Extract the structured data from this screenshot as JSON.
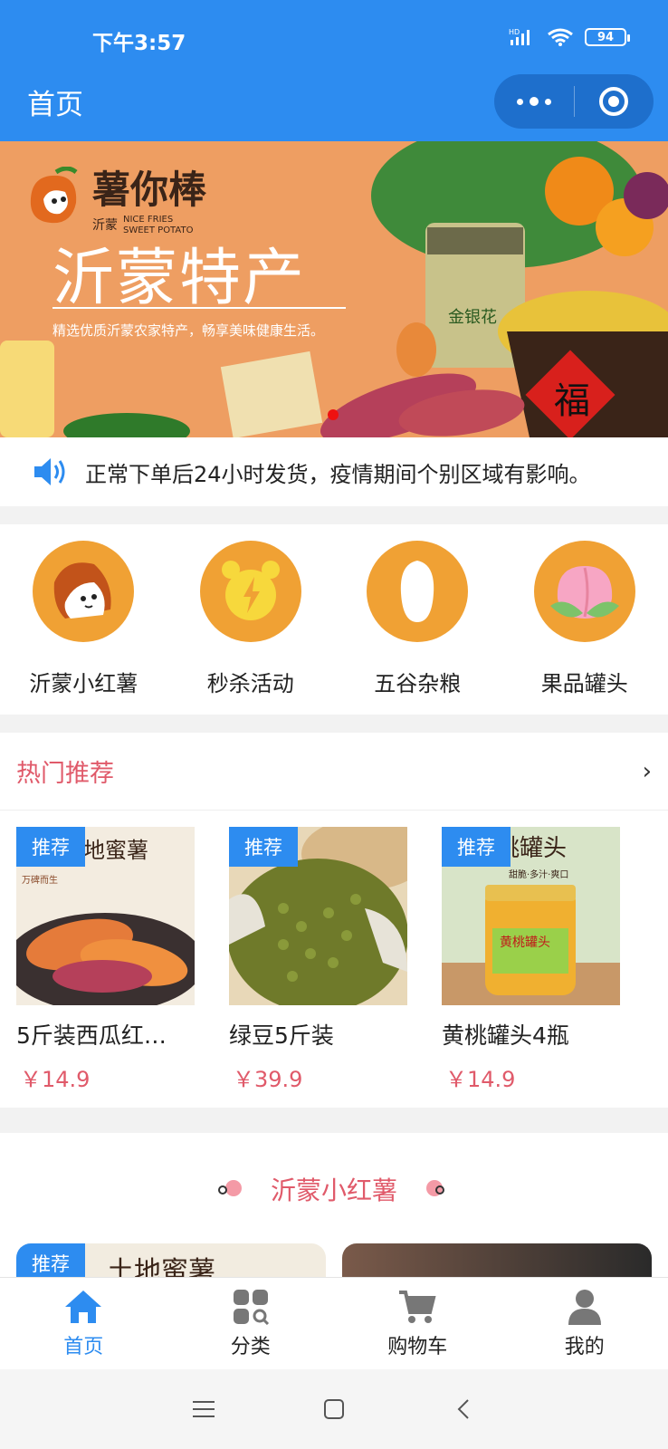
{
  "status_bar": {
    "time": "下午3:57",
    "network": "HD",
    "battery": "94"
  },
  "header": {
    "title": "首页"
  },
  "banner": {
    "brand_name": "薯你棒",
    "brand_sub_cn": "沂蒙",
    "brand_sub_en1": "NICE FRIES",
    "brand_sub_en2": "SWEET POTATO",
    "title": "沂蒙特产",
    "subtitle": "精选优质沂蒙农家特产，畅享美味健康生活。",
    "jar_label": "金银花",
    "bowl_char": "福"
  },
  "notice": {
    "text": "正常下单后24小时发货，疫情期间个别区域有影响。"
  },
  "categories": [
    {
      "label": "沂蒙小红薯",
      "icon": "sweet-potato-icon"
    },
    {
      "label": "秒杀活动",
      "icon": "alarm-clock-icon"
    },
    {
      "label": "五谷杂粮",
      "icon": "grain-icon"
    },
    {
      "label": "果品罐头",
      "icon": "peach-icon"
    }
  ],
  "hot": {
    "title": "热门推荐",
    "products": [
      {
        "tag": "推荐",
        "name": "5斤装西瓜红…",
        "price": "￥14.9",
        "img_text": "地蜜薯",
        "img_sub": "万碑而生"
      },
      {
        "tag": "推荐",
        "name": "绿豆5斤装",
        "price": "￥39.9"
      },
      {
        "tag": "推荐",
        "name": "黄桃罐头4瓶",
        "price": "￥14.9",
        "img_text": "桃罐头",
        "img_sub": "甜脆·多汁·爽口",
        "jar_label": "黄桃罐头"
      }
    ]
  },
  "section2": {
    "title": "沂蒙小红薯",
    "card_tag": "推荐",
    "card_text": "土地蜜薯"
  },
  "tabbar": [
    {
      "label": "首页",
      "icon": "home-icon",
      "active": true
    },
    {
      "label": "分类",
      "icon": "category-icon",
      "active": false
    },
    {
      "label": "购物车",
      "icon": "cart-icon",
      "active": false
    },
    {
      "label": "我的",
      "icon": "user-icon",
      "active": false
    }
  ],
  "colors": {
    "primary": "#2d8cf0",
    "accent": "#e05a6a",
    "category_circle": "#f0a134"
  }
}
